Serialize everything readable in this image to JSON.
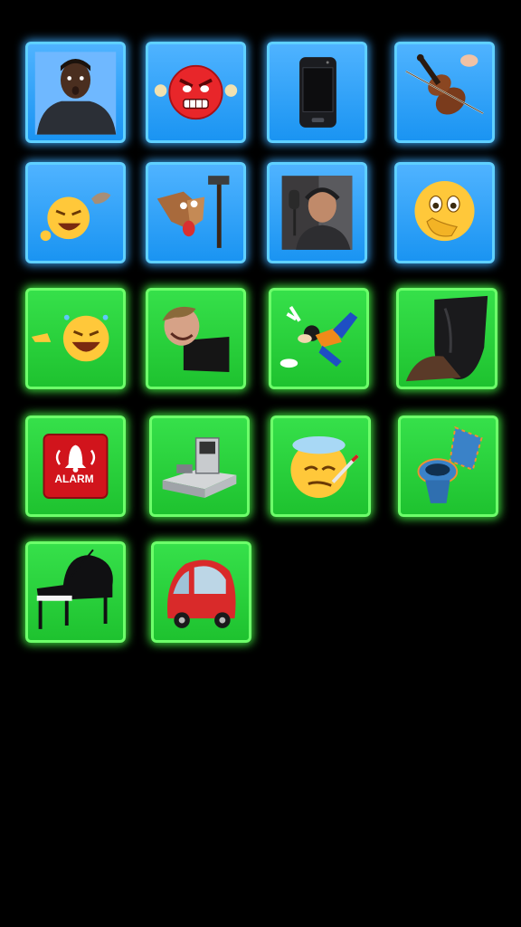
{
  "soundboard": {
    "accent_blue": "#1a94f2",
    "accent_green": "#1ec22f",
    "tiles": [
      {
        "name": "person-surprised-photo",
        "color": "blue"
      },
      {
        "name": "angry-emoji",
        "color": "blue"
      },
      {
        "name": "phone",
        "color": "blue"
      },
      {
        "name": "violin",
        "color": "blue"
      },
      {
        "name": "laughing-emoji",
        "color": "blue"
      },
      {
        "name": "coyote-hammer",
        "color": "blue"
      },
      {
        "name": "singer-microphone-photo",
        "color": "blue"
      },
      {
        "name": "shocked-emoji",
        "color": "blue"
      },
      {
        "name": "pointing-laughing-emoji",
        "color": "green"
      },
      {
        "name": "person-laughing-photo",
        "color": "green"
      },
      {
        "name": "goofy-falling",
        "color": "green"
      },
      {
        "name": "dark-object",
        "color": "green"
      },
      {
        "name": "alarm",
        "color": "green",
        "label": "ALARM"
      },
      {
        "name": "checkout-register",
        "color": "green"
      },
      {
        "name": "sick-emoji",
        "color": "green"
      },
      {
        "name": "toilet",
        "color": "green"
      },
      {
        "name": "piano",
        "color": "green"
      },
      {
        "name": "red-car",
        "color": "green"
      }
    ]
  }
}
